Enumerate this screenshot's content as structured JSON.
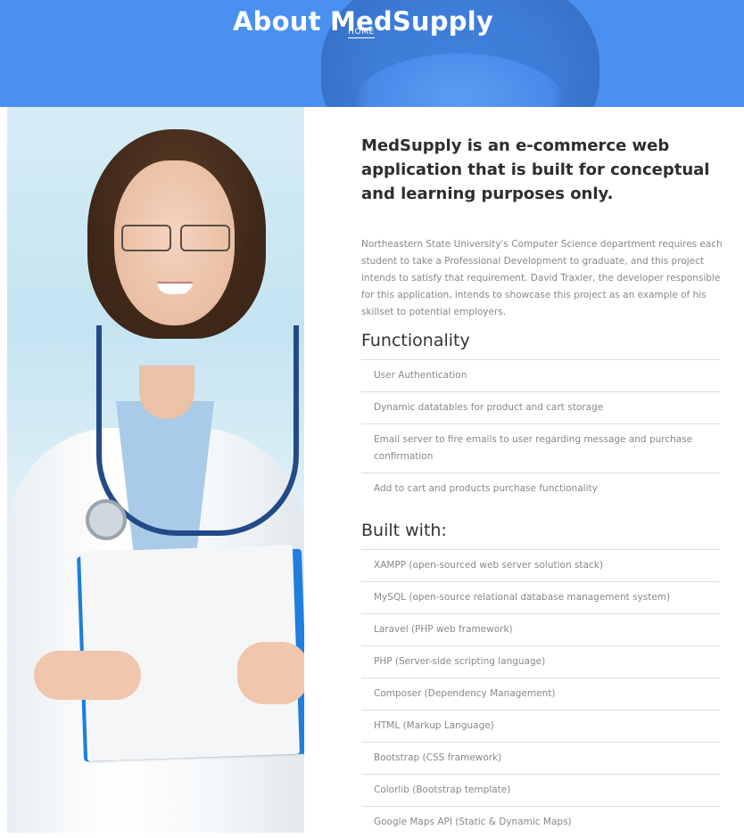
{
  "hero": {
    "title": "About MedSupply",
    "breadcrumb": "HOME",
    "background_color": "#4a90f0"
  },
  "intro": {
    "headline": "MedSupply is an e-commerce web application that is built for conceptual and learning purposes only.",
    "description": "Northeastern State University's Computer Science department requires each student to take a Professional Development to graduate, and this project intends to satisfy that requirement. David Traxler, the developer responsible for this application, intends to showcase this project as an example of his skillset to potential employers."
  },
  "functionality": {
    "title": "Functionality",
    "items": [
      "User Authentication",
      "Dynamic datatables for product and cart storage",
      "Email server to fire emails to user regarding message and purchase confirmation",
      "Add to cart and products purchase functionality"
    ]
  },
  "built_with": {
    "title": "Built with:",
    "items": [
      "XAMPP (open-sourced web server solution stack)",
      "MySQL (open-source relational database management system)",
      "Laravel (PHP web framework)",
      "PHP (Server-side scripting language)",
      "Composer (Dependency Management)",
      "HTML (Markup Language)",
      "Bootstrap (CSS framework)",
      "Colorlib (Bootstrap template)",
      "Google Maps API (Static & Dynamic Maps)"
    ]
  }
}
